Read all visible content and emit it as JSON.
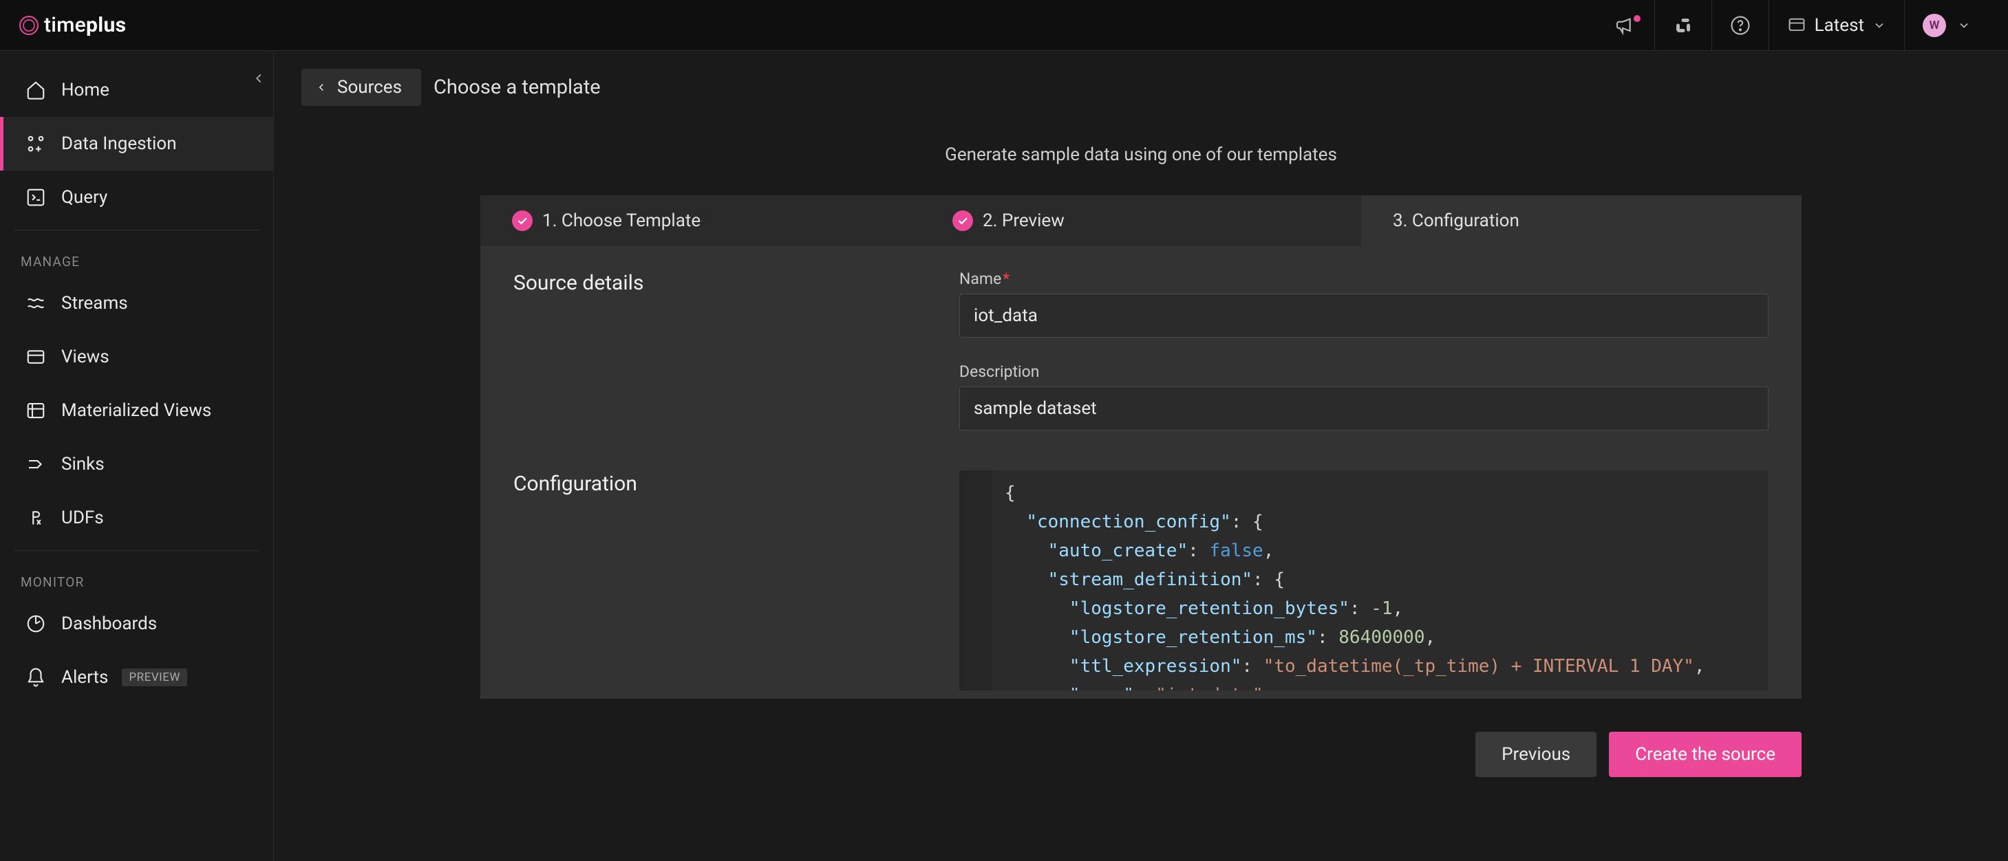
{
  "brand": {
    "name_part1": "time",
    "name_part2": "plus"
  },
  "topbar": {
    "workspace": "Latest",
    "avatar_initial": "W"
  },
  "sidebar": {
    "items": [
      {
        "label": "Home",
        "icon": "home-icon"
      },
      {
        "label": "Data Ingestion",
        "icon": "ingestion-icon"
      },
      {
        "label": "Query",
        "icon": "query-icon"
      }
    ],
    "sections": {
      "manage": {
        "title": "MANAGE",
        "items": [
          {
            "label": "Streams",
            "icon": "streams-icon"
          },
          {
            "label": "Views",
            "icon": "views-icon"
          },
          {
            "label": "Materialized Views",
            "icon": "matviews-icon"
          },
          {
            "label": "Sinks",
            "icon": "sinks-icon"
          },
          {
            "label": "UDFs",
            "icon": "udfs-icon"
          }
        ]
      },
      "monitor": {
        "title": "MONITOR",
        "items": [
          {
            "label": "Dashboards",
            "icon": "dashboards-icon"
          },
          {
            "label": "Alerts",
            "icon": "alerts-icon",
            "badge": "PREVIEW"
          }
        ]
      }
    }
  },
  "page": {
    "back_label": "Sources",
    "title": "Choose a template",
    "subtitle": "Generate sample data using one of our templates"
  },
  "steps": [
    {
      "label": "1. Choose Template",
      "done": true
    },
    {
      "label": "2. Preview",
      "done": true
    },
    {
      "label": "3. Configuration",
      "done": false
    }
  ],
  "form": {
    "source_details_title": "Source details",
    "configuration_title": "Configuration",
    "name_label": "Name",
    "name_value": "iot_data",
    "description_label": "Description",
    "description_value": "sample dataset",
    "config_json": {
      "connection_config": {
        "auto_create": false,
        "stream_definition": {
          "logstore_retention_bytes": -1,
          "logstore_retention_ms": 86400000,
          "ttl_expression": "to_datetime(_tp_time) + INTERVAL 1 DAY",
          "name": "iot_data"
        }
      }
    }
  },
  "footer": {
    "prev": "Previous",
    "create": "Create the source"
  }
}
